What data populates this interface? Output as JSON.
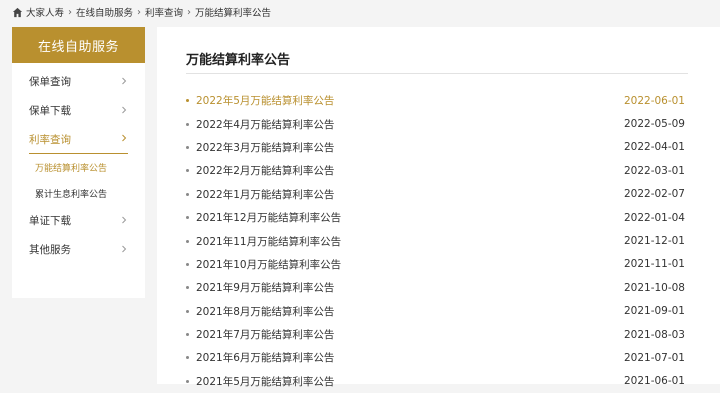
{
  "breadcrumb": {
    "items": [
      "大家人寿",
      "在线自助服务",
      "利率查询",
      "万能结算利率公告"
    ]
  },
  "sidebar": {
    "header": "在线自助服务",
    "items": [
      {
        "label": "保单查询"
      },
      {
        "label": "保单下载"
      },
      {
        "label": "利率查询"
      },
      {
        "label": "单证下载"
      },
      {
        "label": "其他服务"
      }
    ],
    "subitems": [
      {
        "label": "万能结算利率公告"
      },
      {
        "label": "累计生息利率公告"
      }
    ]
  },
  "content": {
    "title": "万能结算利率公告",
    "notices": [
      {
        "title": "2022年5月万能结算利率公告",
        "date": "2022-06-01"
      },
      {
        "title": "2022年4月万能结算利率公告",
        "date": "2022-05-09"
      },
      {
        "title": "2022年3月万能结算利率公告",
        "date": "2022-04-01"
      },
      {
        "title": "2022年2月万能结算利率公告",
        "date": "2022-03-01"
      },
      {
        "title": "2022年1月万能结算利率公告",
        "date": "2022-02-07"
      },
      {
        "title": "2021年12月万能结算利率公告",
        "date": "2022-01-04"
      },
      {
        "title": "2021年11月万能结算利率公告",
        "date": "2021-12-01"
      },
      {
        "title": "2021年10月万能结算利率公告",
        "date": "2021-11-01"
      },
      {
        "title": "2021年9月万能结算利率公告",
        "date": "2021-10-08"
      },
      {
        "title": "2021年8月万能结算利率公告",
        "date": "2021-09-01"
      },
      {
        "title": "2021年7月万能结算利率公告",
        "date": "2021-08-03"
      },
      {
        "title": "2021年6月万能结算利率公告",
        "date": "2021-07-01"
      },
      {
        "title": "2021年5月万能结算利率公告",
        "date": "2021-06-01"
      }
    ]
  },
  "colors": {
    "accent": "#b9902f",
    "page_bg": "#f4f4f4",
    "text": "#333333"
  },
  "icons": {
    "home": "home-icon",
    "breadcrumb_separator": "chevron-right-icon",
    "menu_arrow": "chevron-right-icon"
  }
}
